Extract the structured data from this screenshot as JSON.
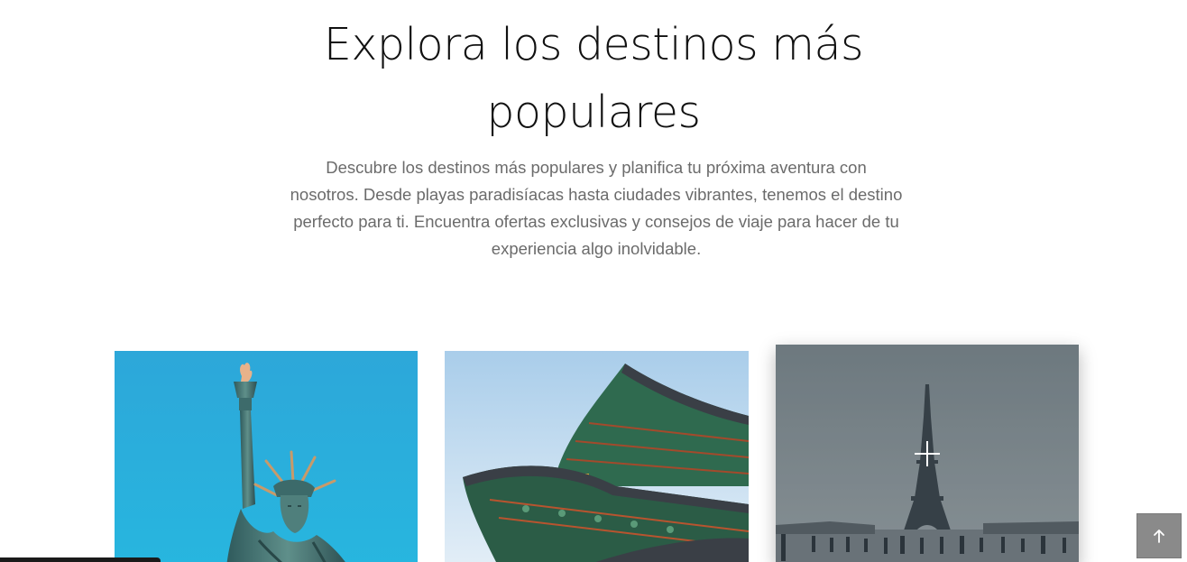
{
  "section": {
    "title_line_1": "Explora los destinos más",
    "title_line_2": "populares",
    "description_lines": [
      "Descubre los destinos más populares y planifica tu próxima aventura con",
      "nosotros. Desde playas paradisíacas hasta ciudades vibrantes, tenemos el destino",
      "perfecto para ti. Encuentra ofertas exclusivas y consejos de viaje para hacer de tu",
      "experiencia algo inolvidable."
    ]
  },
  "cards": [
    {
      "image": "statue-of-liberty",
      "background": "#2fa9d8"
    },
    {
      "image": "korean-palace-roof",
      "background": "#c9dff0"
    },
    {
      "image": "eiffel-tower",
      "background": "#6f7b80",
      "hover_icon": "plus-icon"
    }
  ],
  "controls": {
    "back_to_top_icon": "arrow-up-icon",
    "back_to_top_color": "#8a8a8a"
  }
}
